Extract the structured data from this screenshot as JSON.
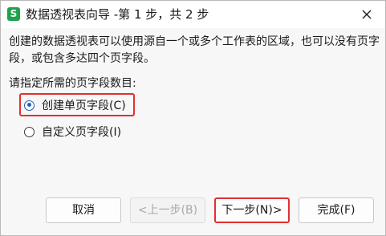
{
  "window": {
    "title": "数据透视表向导 -第 1 步，共 2 步",
    "app_icon_letter": "S",
    "close_icon": "close-icon"
  },
  "content": {
    "description": "创建的数据透视表可以使用源自一个或多个工作表的区域，也可以没有页字段，或包含多达四个页字段。",
    "prompt": "请指定所需的页字段数目:",
    "options": [
      {
        "label": "创建单页字段(C)",
        "checked": true,
        "highlighted": true
      },
      {
        "label": "自定义页字段(I)",
        "checked": false,
        "highlighted": false
      }
    ]
  },
  "buttons": {
    "cancel": "取消",
    "prev": "<上一步(B)",
    "next": "下一步(N)>",
    "finish": "完成(F)"
  },
  "colors": {
    "highlight_border": "#e03030",
    "radio_selected": "#2060b0",
    "app_icon_bg": "#1fa24c"
  }
}
